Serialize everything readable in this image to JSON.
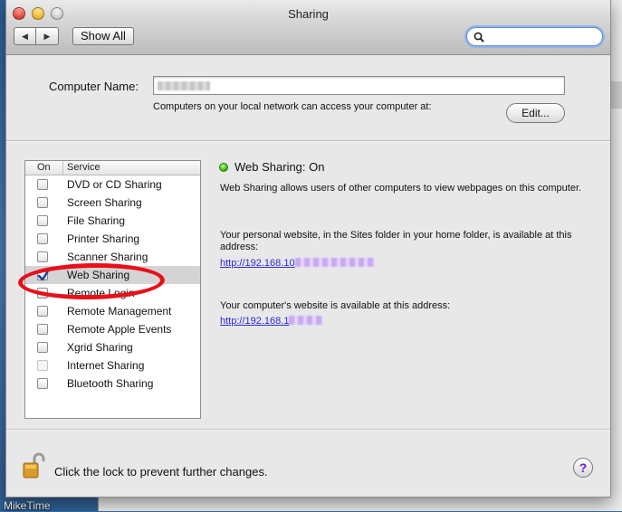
{
  "window": {
    "title": "Sharing",
    "show_all_label": "Show All",
    "search_placeholder": ""
  },
  "computer_name": {
    "label": "Computer Name:",
    "value": "",
    "description": "Computers on your local network can access your computer at:",
    "edit_label": "Edit..."
  },
  "services": {
    "header_on": "On",
    "header_service": "Service",
    "items": [
      {
        "label": "DVD or CD Sharing",
        "checked": false
      },
      {
        "label": "Screen Sharing",
        "checked": false
      },
      {
        "label": "File Sharing",
        "checked": false
      },
      {
        "label": "Printer Sharing",
        "checked": false
      },
      {
        "label": "Scanner Sharing",
        "checked": false
      },
      {
        "label": "Web Sharing",
        "checked": true,
        "selected": true
      },
      {
        "label": "Remote Login",
        "checked": false
      },
      {
        "label": "Remote Management",
        "checked": false
      },
      {
        "label": "Remote Apple Events",
        "checked": false
      },
      {
        "label": "Xgrid Sharing",
        "checked": false
      },
      {
        "label": "Internet Sharing",
        "checked": false,
        "disabled": true
      },
      {
        "label": "Bluetooth Sharing",
        "checked": false
      }
    ]
  },
  "detail": {
    "status": "Web Sharing: On",
    "status_color": "#35c10d",
    "description": "Web Sharing allows users of other computers to view webpages on this computer.",
    "personal_desc": "Your personal website, in the Sites folder in your home folder, is available at this address:",
    "personal_url": "http://192.168.10",
    "computer_desc": "Your computer's website is available at this address:",
    "computer_url": "http://192.168.1"
  },
  "footer": {
    "lock_text": "Click the lock to prevent further changes.",
    "help_label": "?"
  },
  "desktop": {
    "label": "MikeTime"
  },
  "annotation_color": "#e8101a"
}
